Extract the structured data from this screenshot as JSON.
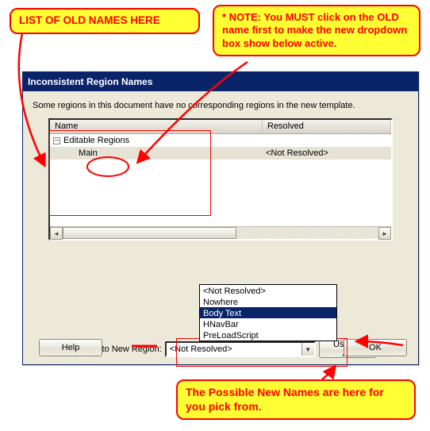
{
  "callouts": {
    "old_names": "LIST OF OLD NAMES HERE",
    "note": "* NOTE: You MUST click on the OLD name first to make the new dropdown box show below active.",
    "new_names": "The Possible New Names are here for you pick from."
  },
  "dialog": {
    "title": "Inconsistent Region Names",
    "instruction": "Some regions in this document have no corresponding regions in the new template.",
    "columns": {
      "name": "Name",
      "resolved": "Resolved"
    },
    "group": {
      "label": "Editable Regions",
      "expander": "–"
    },
    "item": {
      "name": "Main",
      "resolved": "<Not Resolved>"
    },
    "move_label": "Move Content to New Region:",
    "combo_value": "<Not Resolved>",
    "use_for_all": "Use for All",
    "help": "Help",
    "ok": "OK"
  },
  "dropdown": {
    "options": [
      "<Not Resolved>",
      "Nowhere",
      "Body Text",
      "HNavBar",
      "PreLoadScript"
    ],
    "selected": "Body Text"
  },
  "scroll": {
    "left": "◄",
    "right": "►",
    "down": "▼"
  }
}
